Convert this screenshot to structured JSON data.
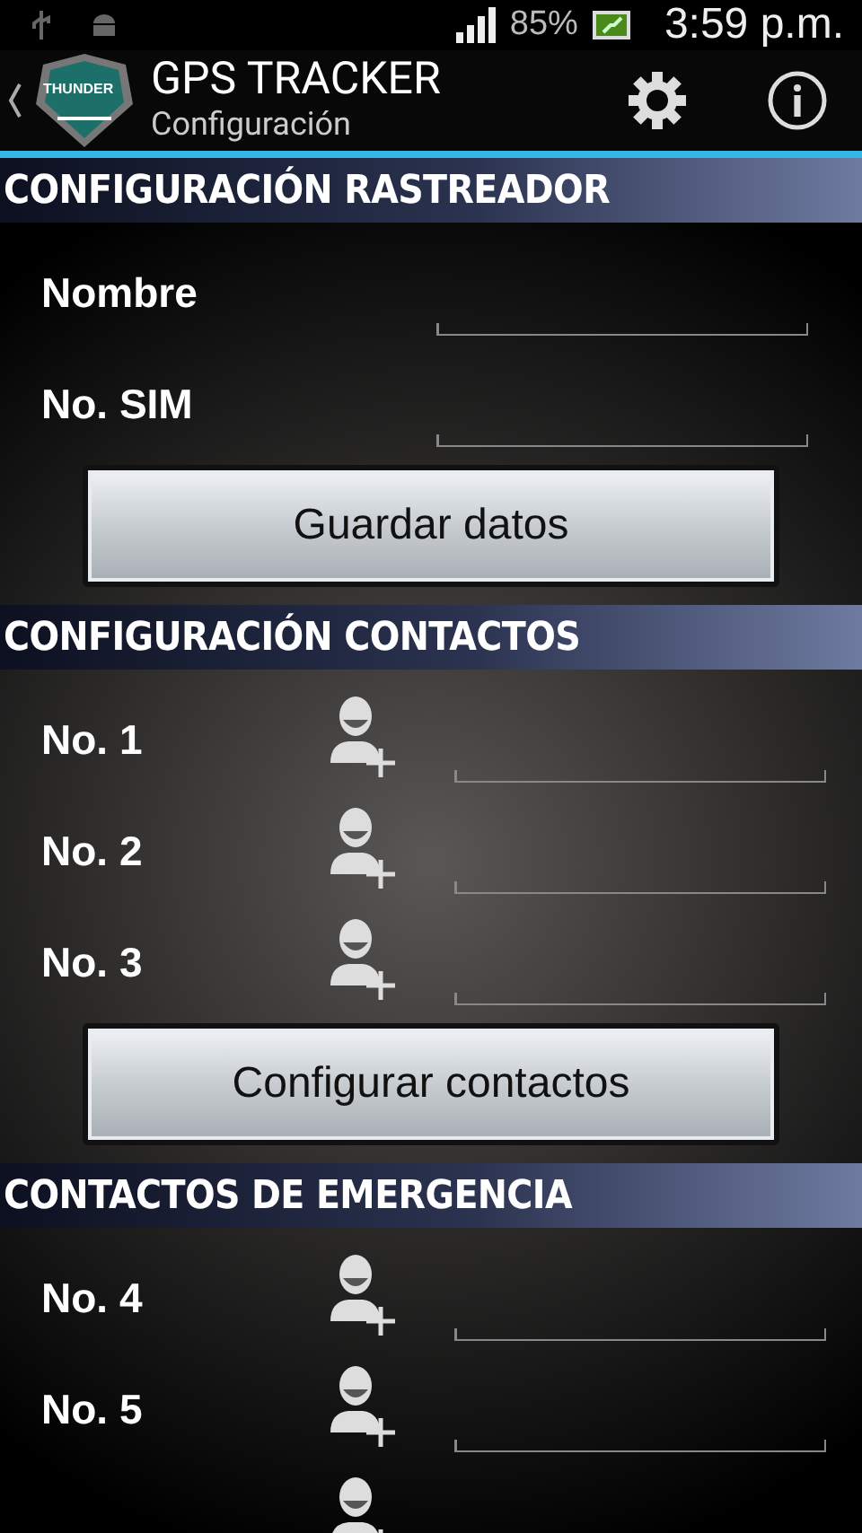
{
  "status_bar": {
    "battery": "85%",
    "time": "3:59 p.m."
  },
  "action_bar": {
    "title": "GPS TRACKER",
    "subtitle": "Configuración",
    "logo_text": "THUNDER"
  },
  "sections": [
    {
      "title": "CONFIGURACIÓN RASTREADOR",
      "rows": [
        {
          "kind": "field",
          "label": "Nombre"
        },
        {
          "kind": "field",
          "label": "No. SIM"
        }
      ],
      "button": "Guardar datos"
    },
    {
      "title": "CONFIGURACIÓN CONTACTOS",
      "rows": [
        {
          "kind": "contact",
          "label": "No. 1"
        },
        {
          "kind": "contact",
          "label": "No. 2"
        },
        {
          "kind": "contact",
          "label": "No. 3"
        }
      ],
      "button": "Configurar contactos"
    },
    {
      "title": "CONTACTOS DE EMERGENCIA",
      "rows": [
        {
          "kind": "contact",
          "label": "No. 4"
        },
        {
          "kind": "contact",
          "label": "No. 5"
        },
        {
          "kind": "contact_icon_only"
        }
      ]
    }
  ]
}
